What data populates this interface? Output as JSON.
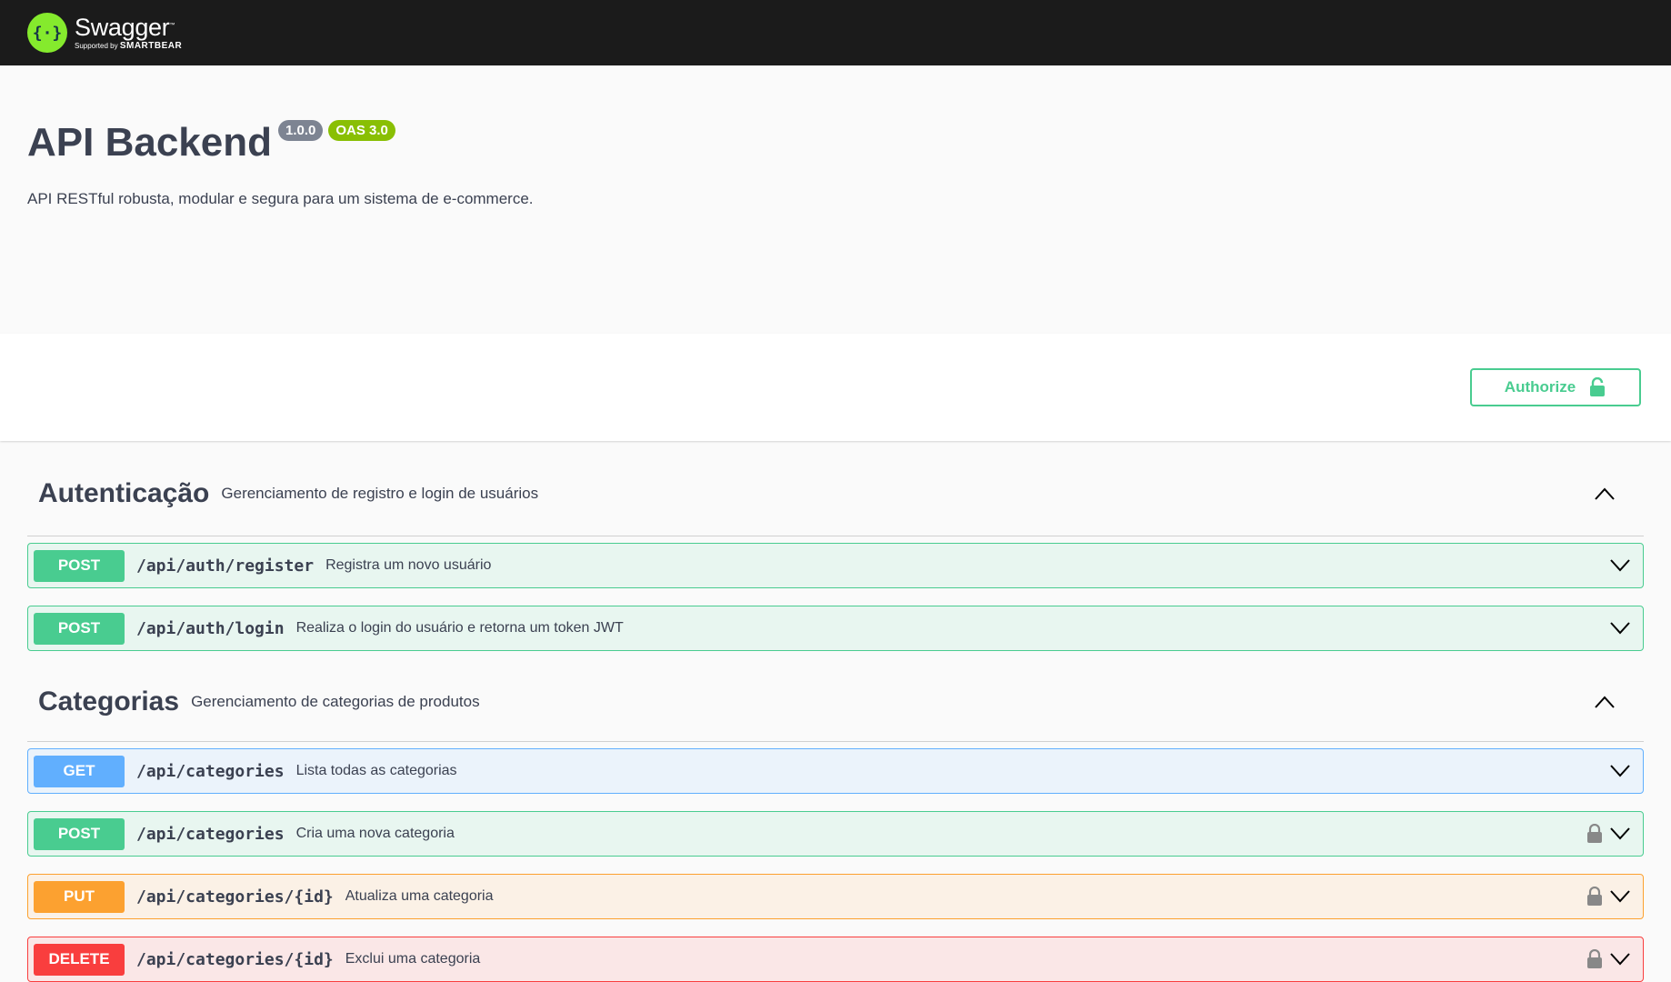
{
  "header": {
    "logo_name": "Swagger",
    "logo_supported_by": "Supported by",
    "logo_company": "SMARTBEAR",
    "colors": {
      "background": "#1b1b1b",
      "logo_green": "#85ea2d"
    }
  },
  "info": {
    "title": "API Backend",
    "version": "1.0.0",
    "oas_badge": "OAS 3.0",
    "description": "API RESTful robusta, modular e segura para um sistema de e-commerce."
  },
  "auth": {
    "authorize_label": "Authorize",
    "icon": "unlock-icon"
  },
  "tags": [
    {
      "name": "Autenticação",
      "description": "Gerenciamento de registro e login de usuários",
      "expanded": true,
      "operations": [
        {
          "method": "POST",
          "path": "/api/auth/register",
          "summary": "Registra um novo usuário",
          "locked": false
        },
        {
          "method": "POST",
          "path": "/api/auth/login",
          "summary": "Realiza o login do usuário e retorna um token JWT",
          "locked": false
        }
      ]
    },
    {
      "name": "Categorias",
      "description": "Gerenciamento de categorias de produtos",
      "expanded": true,
      "operations": [
        {
          "method": "GET",
          "path": "/api/categories",
          "summary": "Lista todas as categorias",
          "locked": false
        },
        {
          "method": "POST",
          "path": "/api/categories",
          "summary": "Cria uma nova categoria",
          "locked": true
        },
        {
          "method": "PUT",
          "path": "/api/categories/{id}",
          "summary": "Atualiza uma categoria",
          "locked": true
        },
        {
          "method": "DELETE",
          "path": "/api/categories/{id}",
          "summary": "Exclui uma categoria",
          "locked": true
        }
      ]
    }
  ],
  "method_colors": {
    "POST": "#49cc90",
    "GET": "#61affe",
    "PUT": "#fca130",
    "DELETE": "#f93e3e"
  }
}
